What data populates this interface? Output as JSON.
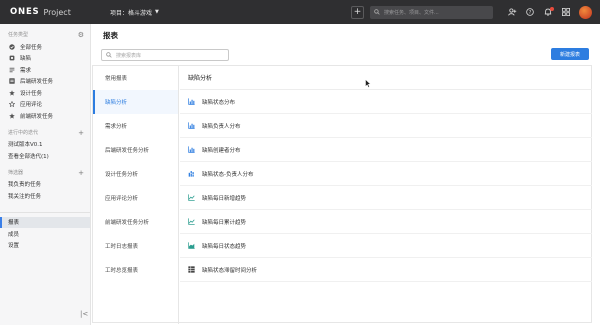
{
  "topbar": {
    "brand": "ONES",
    "product": "Project",
    "project_label": "项目：格斗游戏",
    "search_placeholder": "搜索任务、项目、文件...",
    "icons": [
      "plus-icon",
      "search-icon",
      "add-user-icon",
      "help-icon",
      "bell-icon",
      "grid-icon",
      "avatar"
    ]
  },
  "sidebar": {
    "task_types_title": "任务类型",
    "task_types": [
      {
        "label": "全部任务",
        "icon": "all-tasks-icon"
      },
      {
        "label": "缺陷",
        "icon": "bug-icon"
      },
      {
        "label": "需求",
        "icon": "requirement-icon"
      },
      {
        "label": "后端研发任务",
        "icon": "backend-task-icon"
      },
      {
        "label": "设计任务",
        "icon": "star-icon"
      },
      {
        "label": "应用评论",
        "icon": "comment-icon"
      },
      {
        "label": "前端研发任务",
        "icon": "star-icon"
      }
    ],
    "iterations_title": "进行中的迭代",
    "iterations": [
      "测试版本V0.1",
      "查看全部迭代(1)"
    ],
    "filters_title": "筛选器",
    "filters": [
      "我负责的任务",
      "我关注的任务"
    ],
    "nav": [
      "报表",
      "成员",
      "设置"
    ],
    "active_nav": "报表"
  },
  "main": {
    "title": "报表",
    "search_placeholder": "搜索报表库",
    "new_button": "新建报表",
    "categories": [
      "常用报表",
      "缺陷分析",
      "需求分析",
      "后端研发任务分析",
      "设计任务分析",
      "应用评论分析",
      "前端研发任务分析",
      "工时日志报表",
      "工时总览报表"
    ],
    "active_category": "缺陷分析",
    "section_title": "缺陷分析",
    "reports": [
      {
        "label": "缺陷状态分布",
        "icon": "bar-chart-icon"
      },
      {
        "label": "缺陷负责人分布",
        "icon": "bar-chart-icon"
      },
      {
        "label": "缺陷创建者分布",
        "icon": "bar-chart-icon"
      },
      {
        "label": "缺陷状态-负责人分布",
        "icon": "stacked-bar-icon"
      },
      {
        "label": "缺陷每日新增趋势",
        "icon": "line-chart-icon"
      },
      {
        "label": "缺陷每日累计趋势",
        "icon": "line-chart-icon"
      },
      {
        "label": "缺陷每日状态趋势",
        "icon": "area-chart-icon"
      },
      {
        "label": "缺陷状态滞留时间分析",
        "icon": "table-icon"
      }
    ]
  },
  "colors": {
    "accent": "#2d7de0",
    "topbar": "#2f2f31",
    "sidebar": "#f6f6f7",
    "notification": "#e84b3c"
  }
}
